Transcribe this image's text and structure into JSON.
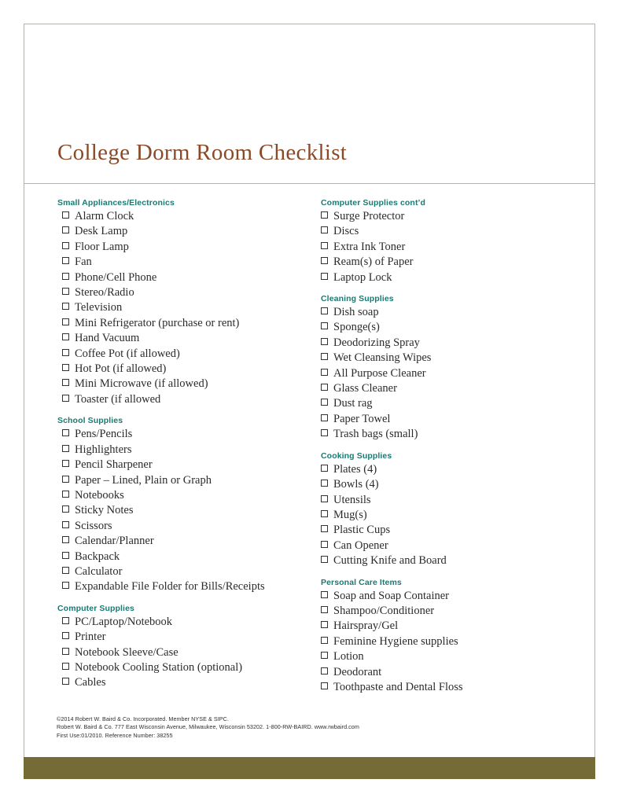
{
  "document": {
    "title": "College Dorm Room Checklist"
  },
  "columns": {
    "left": [
      {
        "title": "Small Appliances/Electronics",
        "items": [
          "Alarm Clock",
          "Desk Lamp",
          "Floor Lamp",
          "Fan",
          "Phone/Cell Phone",
          "Stereo/Radio",
          "Television",
          "Mini Refrigerator (purchase or rent)",
          "Hand Vacuum",
          "Coffee Pot (if allowed)",
          "Hot Pot (if allowed)",
          "Mini Microwave (if allowed)",
          "Toaster (if allowed"
        ]
      },
      {
        "title": "School Supplies",
        "items": [
          "Pens/Pencils",
          "Highlighters",
          "Pencil Sharpener",
          "Paper – Lined, Plain or Graph",
          "Notebooks",
          "Sticky Notes",
          "Scissors",
          "Calendar/Planner",
          "Backpack",
          "Calculator",
          "Expandable File Folder for Bills/Receipts"
        ]
      },
      {
        "title": "Computer Supplies",
        "items": [
          "PC/Laptop/Notebook",
          "Printer",
          "Notebook Sleeve/Case",
          "Notebook Cooling Station (optional)",
          "Cables"
        ]
      }
    ],
    "right": [
      {
        "title": "Computer Supplies cont’d",
        "items": [
          "Surge Protector",
          "Discs",
          "Extra Ink Toner",
          "Ream(s) of Paper",
          "Laptop Lock"
        ]
      },
      {
        "title": "Cleaning Supplies",
        "items": [
          "Dish soap",
          "Sponge(s)",
          "Deodorizing Spray",
          "Wet Cleansing Wipes",
          "All Purpose Cleaner",
          "Glass Cleaner",
          "Dust rag",
          "Paper Towel",
          "Trash bags (small)"
        ]
      },
      {
        "title": "Cooking Supplies",
        "items": [
          "Plates (4)",
          "Bowls (4)",
          "Utensils",
          "Mug(s)",
          "Plastic Cups",
          "Can Opener",
          "Cutting Knife and Board"
        ]
      },
      {
        "title": "Personal Care Items",
        "items": [
          "Soap and Soap Container",
          "Shampoo/Conditioner",
          "Hairspray/Gel",
          "Feminine Hygiene supplies",
          "Lotion",
          "Deodorant",
          "Toothpaste and Dental Floss"
        ]
      }
    ]
  },
  "footer": {
    "line1": "©2014 Robert W. Baird & Co. Incorporated. Member NYSE & SIPC.",
    "line2": "Robert W. Baird & Co. 777 East Wisconsin Avenue, Milwaukee, Wisconsin 53202. 1-800-RW-BAIRD. www.rwbaird.com",
    "line3": "First Use:01/2010. Reference Number: 38255"
  },
  "colors": {
    "title": "#8a4a28",
    "section_heading": "#1a7a72",
    "bottom_bar": "#746b36",
    "page_border": "#b4b2ac"
  }
}
